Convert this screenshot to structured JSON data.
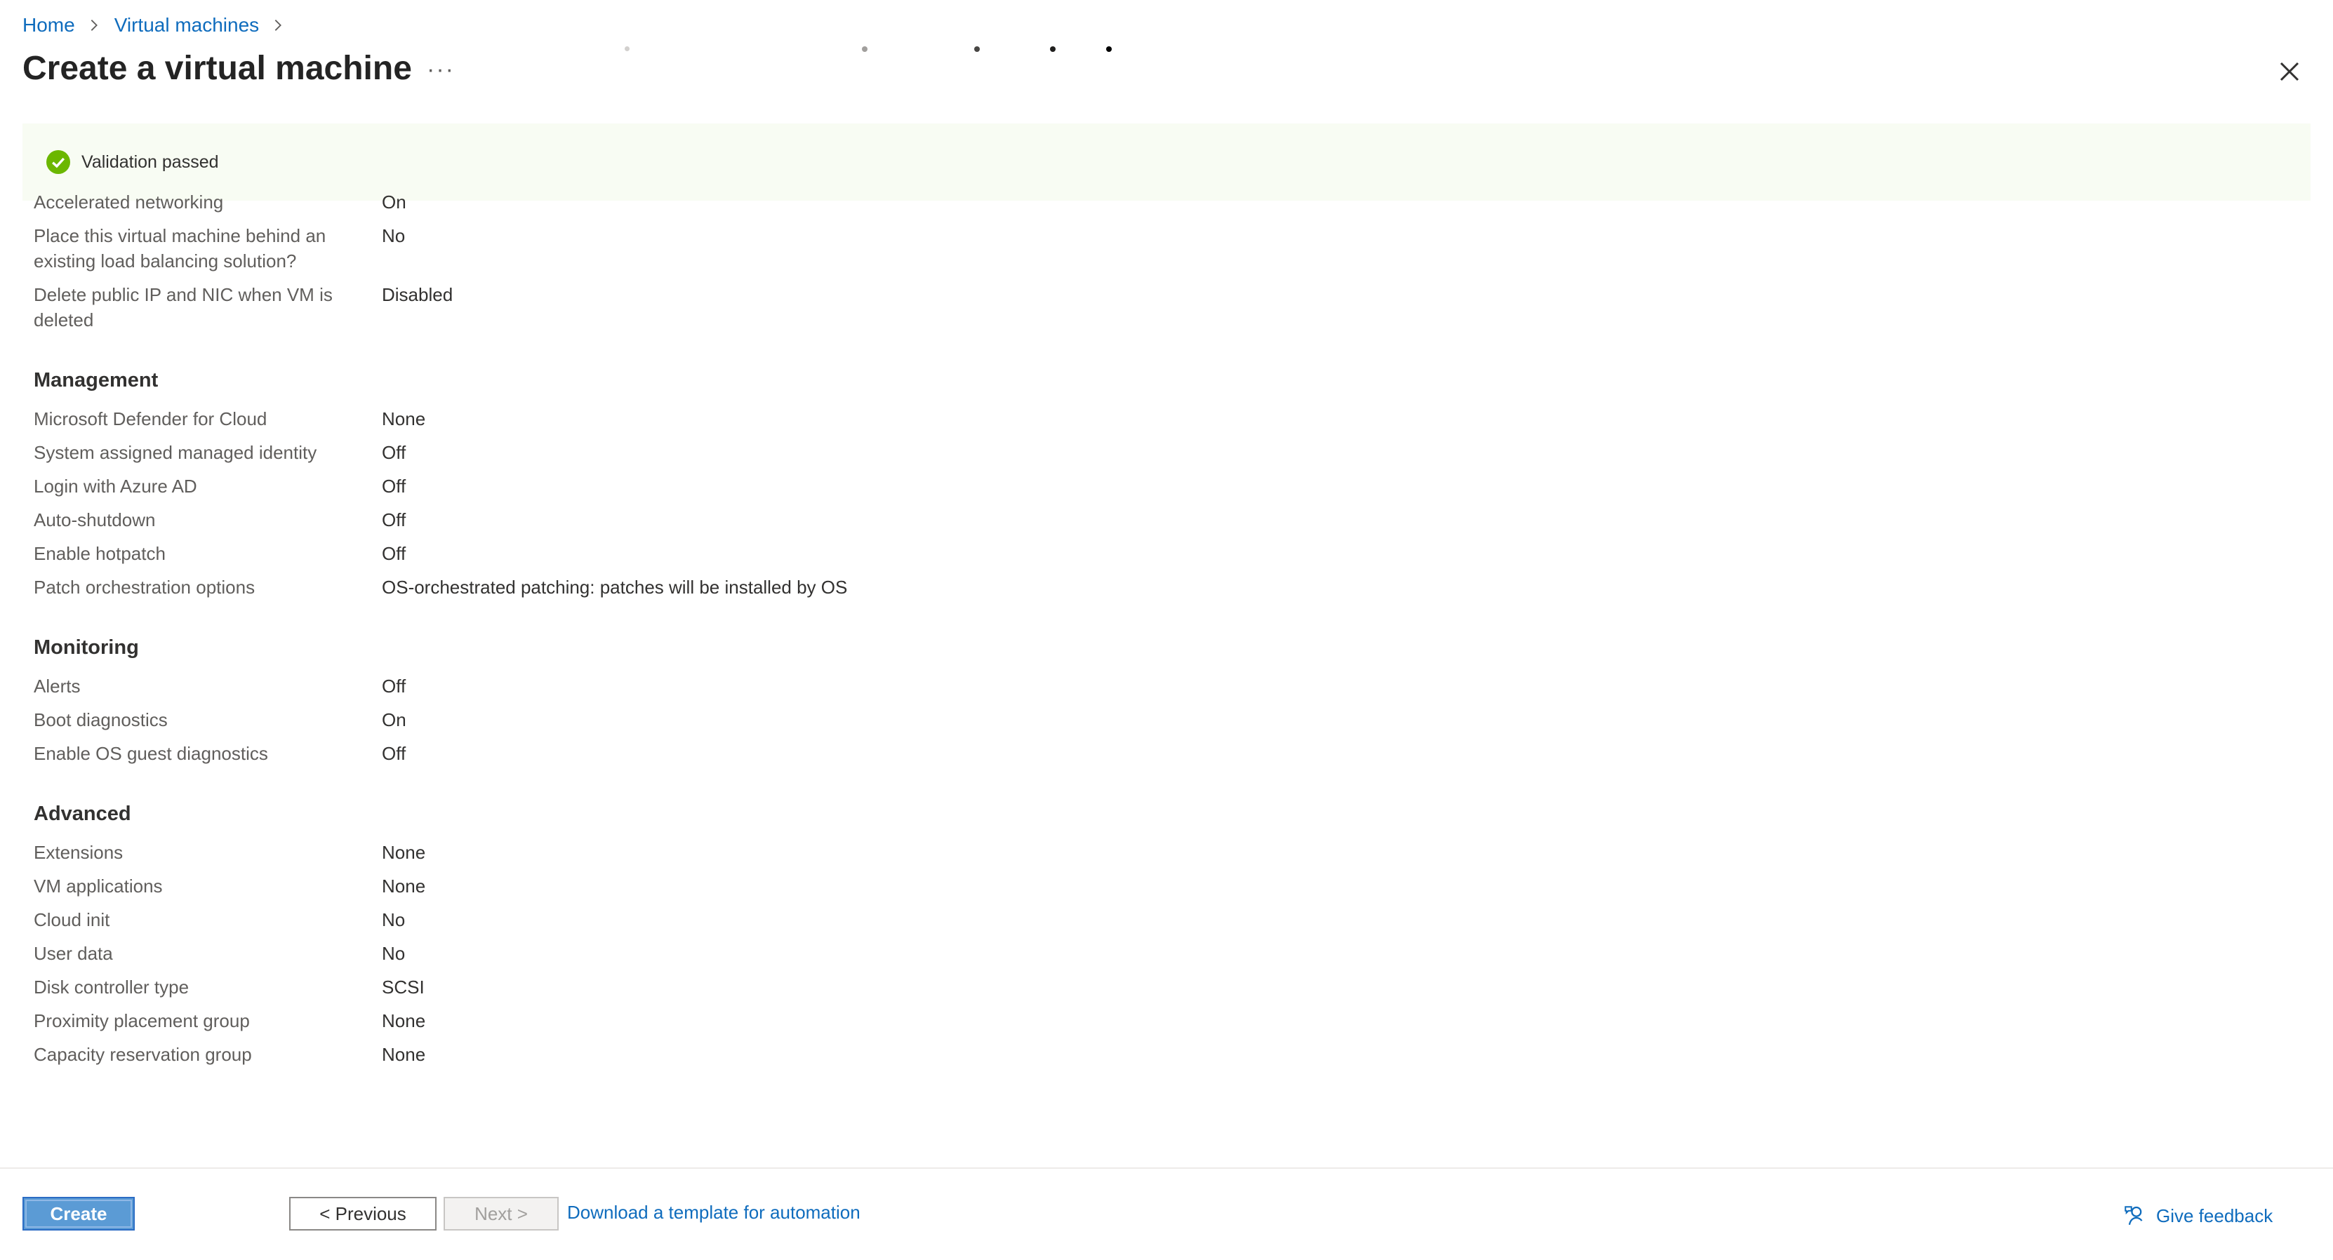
{
  "breadcrumb": {
    "home": "Home",
    "virtual_machines": "Virtual machines"
  },
  "page": {
    "title": "Create a virtual machine",
    "more": "···"
  },
  "validation": {
    "message": "Validation passed",
    "color": "#6bb700"
  },
  "networking": {
    "rows": [
      {
        "label": "Accelerated networking",
        "value": "On"
      },
      {
        "label": "Place this virtual machine behind an existing load balancing solution?",
        "value": "No"
      },
      {
        "label": "Delete public IP and NIC when VM is deleted",
        "value": "Disabled"
      }
    ]
  },
  "management": {
    "title": "Management",
    "rows": [
      {
        "label": "Microsoft Defender for Cloud",
        "value": "None"
      },
      {
        "label": "System assigned managed identity",
        "value": "Off"
      },
      {
        "label": "Login with Azure AD",
        "value": "Off"
      },
      {
        "label": "Auto-shutdown",
        "value": "Off"
      },
      {
        "label": "Enable hotpatch",
        "value": "Off"
      },
      {
        "label": "Patch orchestration options",
        "value": "OS-orchestrated patching: patches will be installed by OS"
      }
    ]
  },
  "monitoring": {
    "title": "Monitoring",
    "rows": [
      {
        "label": "Alerts",
        "value": "Off"
      },
      {
        "label": "Boot diagnostics",
        "value": "On"
      },
      {
        "label": "Enable OS guest diagnostics",
        "value": "Off"
      }
    ]
  },
  "advanced": {
    "title": "Advanced",
    "rows": [
      {
        "label": "Extensions",
        "value": "None"
      },
      {
        "label": "VM applications",
        "value": "None"
      },
      {
        "label": "Cloud init",
        "value": "No"
      },
      {
        "label": "User data",
        "value": "No"
      },
      {
        "label": "Disk controller type",
        "value": "SCSI"
      },
      {
        "label": "Proximity placement group",
        "value": "None"
      },
      {
        "label": "Capacity reservation group",
        "value": "None"
      }
    ]
  },
  "footer": {
    "create": "Create",
    "previous": "< Previous",
    "next": "Next >",
    "download": "Download a template for automation",
    "feedback": "Give feedback"
  },
  "colors": {
    "accent": "#0f6cbd",
    "create_button": "#5b9bd5"
  },
  "icons": {
    "breadcrumb_separator": "chevron-right-icon",
    "close": "close-icon",
    "validation": "check-circle-icon",
    "feedback": "feedback-icon"
  }
}
